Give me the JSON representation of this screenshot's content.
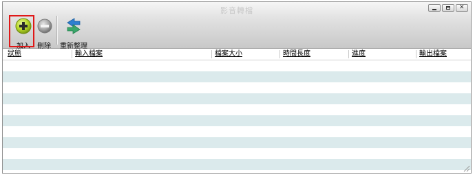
{
  "window": {
    "title": "影音轉檔"
  },
  "toolbar": {
    "add_label": "加入",
    "delete_label": "刪除",
    "reorganize_label": "重新整理"
  },
  "table": {
    "columns": [
      "狀態",
      "輸入檔案",
      "檔案大小",
      "時間長度",
      "進度",
      "輸出檔案"
    ]
  },
  "colors": {
    "row_alt": "#dbeaec",
    "highlight": "#e01818",
    "add_icon": "#b8d82a",
    "delete_icon": "#9a9a9a",
    "refresh_blue": "#2d7fd0",
    "refresh_green": "#3aa66a"
  }
}
